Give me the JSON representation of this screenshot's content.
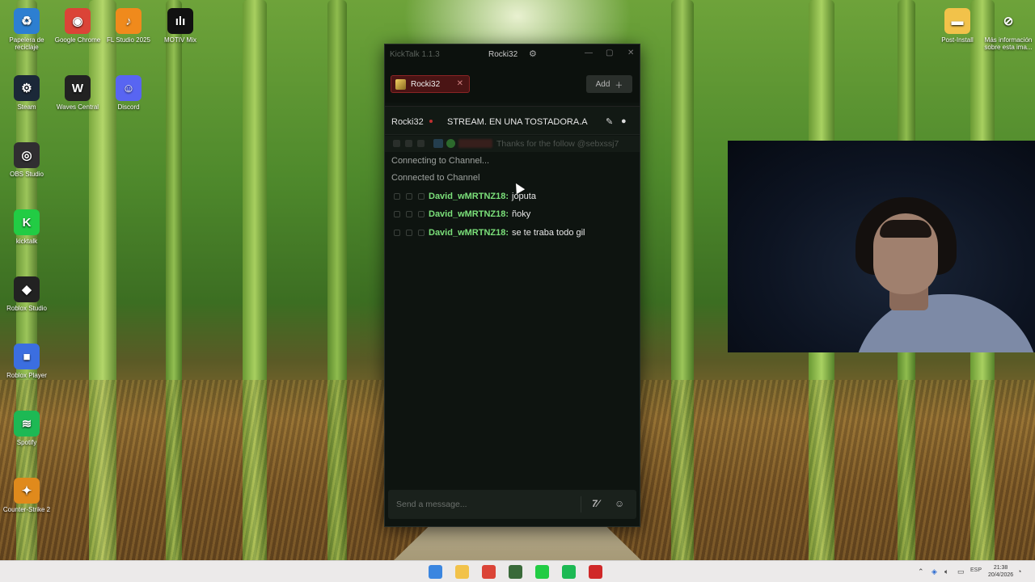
{
  "desktop": {
    "icons_left": [
      {
        "label": "Papelera de reciclaje",
        "icon": "recycle-bin-icon",
        "color": "#2d7fd1",
        "glyph": "♻"
      },
      {
        "label": "Google Chrome",
        "icon": "chrome-icon",
        "color": "#db4437",
        "glyph": "◉"
      },
      {
        "label": "FL Studio 2025",
        "icon": "fl-studio-icon",
        "color": "#f08a1c",
        "glyph": "♪"
      },
      {
        "label": "MOTIV Mix",
        "icon": "motiv-mix-icon",
        "color": "#111111",
        "glyph": "ılı"
      },
      {
        "label": "Steam",
        "icon": "steam-icon",
        "color": "#1b2838",
        "glyph": "⚙"
      },
      {
        "label": "Waves Central",
        "icon": "waves-central-icon",
        "color": "#222222",
        "glyph": "W"
      },
      {
        "label": "Discord",
        "icon": "discord-icon",
        "color": "#5865f2",
        "glyph": "☺"
      },
      {
        "label": "OBS Studio",
        "icon": "obs-icon",
        "color": "#302e31",
        "glyph": "◎"
      },
      {
        "label": "kicktalk",
        "icon": "kicktalk-icon",
        "color": "#22cc44",
        "glyph": "K"
      },
      {
        "label": "Roblox Studio",
        "icon": "roblox-studio-icon",
        "color": "#222222",
        "glyph": "◆"
      },
      {
        "label": "Roblox Player",
        "icon": "roblox-player-icon",
        "color": "#3b6ee0",
        "glyph": "■"
      },
      {
        "label": "Spotify",
        "icon": "spotify-icon",
        "color": "#1db954",
        "glyph": "≋"
      },
      {
        "label": "Counter-Strike 2",
        "icon": "counter-strike-icon",
        "color": "#e08a1c",
        "glyph": "✦"
      }
    ],
    "icons_right": [
      {
        "label": "Post-Install",
        "icon": "folder-icon",
        "color": "#f2c24a",
        "glyph": "▬"
      },
      {
        "label": "Más información sobre esta ima...",
        "icon": "camera-info-icon",
        "color": "transparent",
        "glyph": "⊘"
      }
    ]
  },
  "window": {
    "app_title": "KickTalk 1.1.3",
    "channel_title": "Rocki32",
    "tab_label": "Rocki32",
    "add_label": "Add",
    "header": {
      "channel": "Rocki32",
      "stream_title": "STREAM. EN UNA TOSTADORA.A"
    },
    "pinned": {
      "text": "Thanks for the follow @sebxssj7"
    },
    "system_messages": [
      "Connecting to Channel...",
      "Connected to Channel"
    ],
    "messages": [
      {
        "user": "David_wMRTNZ18:",
        "text": "joputa"
      },
      {
        "user": "David_wMRTNZ18:",
        "text": "ñoky"
      },
      {
        "user": "David_wMRTNZ18:",
        "text": "se te traba todo gil"
      }
    ],
    "composer": {
      "placeholder": "Send a message..."
    }
  },
  "taskbar": {
    "apps": [
      {
        "icon": "start-icon",
        "color": "#3b86e0"
      },
      {
        "icon": "file-explorer-icon",
        "color": "#f2c24a"
      },
      {
        "icon": "chrome-icon",
        "color": "#db4437"
      },
      {
        "icon": "game-icon",
        "color": "#3a6a3a"
      },
      {
        "icon": "kicktalk-icon",
        "color": "#22cc44"
      },
      {
        "icon": "spotify-icon",
        "color": "#1db954"
      },
      {
        "icon": "app-icon",
        "color": "#d02828"
      }
    ],
    "clock_time": "21:38",
    "clock_date": "20/4/2026",
    "lang": "ESP"
  },
  "colors": {
    "username": "#7be07a",
    "tab_accent": "#8a2424",
    "window_bg": "#0e1410"
  }
}
